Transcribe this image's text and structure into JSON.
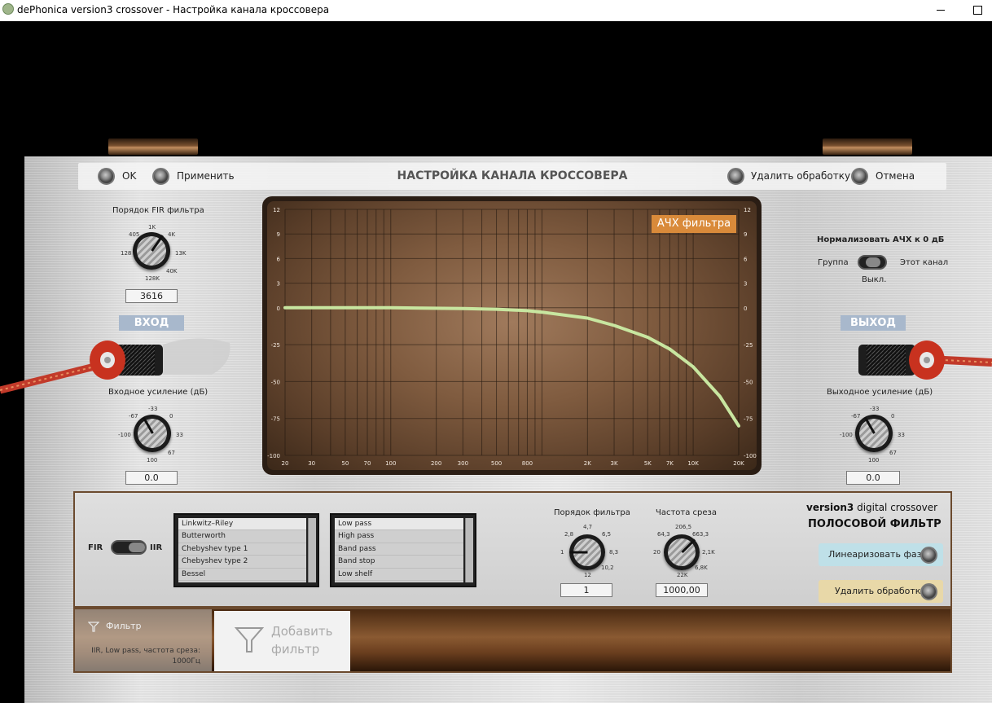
{
  "window": {
    "title": "dePhonica version3 crossover - Настройка канала кроссовера"
  },
  "header": {
    "ok_label": "OK",
    "apply_label": "Применить",
    "title": "НАСТРОЙКА КАНАЛА КРОССОВЕРА",
    "remove_processing_label": "Удалить обработку",
    "cancel_label": "Отмена"
  },
  "fir_order": {
    "label": "Порядок FIR фильтра",
    "ticks": [
      "405",
      "1K",
      "4K",
      "128",
      "13K",
      "128K",
      "40K"
    ],
    "value": "3616"
  },
  "input": {
    "plaque": "ВХОД",
    "gain_label": "Входное усиление (дБ)",
    "ticks": [
      "-33",
      "-67",
      "0",
      "-100",
      "33",
      "100",
      "67"
    ],
    "value": "0.0"
  },
  "output": {
    "plaque": "ВЫХОД",
    "gain_label": "Выходное усиление (дБ)",
    "ticks": [
      "-33",
      "-67",
      "0",
      "-100",
      "33",
      "100",
      "67"
    ],
    "value": "0.0"
  },
  "normalize": {
    "title": "Нормализовать АЧХ к 0 дБ",
    "group_label": "Группа",
    "channel_label": "Этот канал",
    "off_label": "Выкл."
  },
  "graph": {
    "badge": "АЧХ фильтра"
  },
  "chart_data": {
    "type": "line",
    "title": "АЧХ фильтра",
    "xscale": "log",
    "x_ticks": [
      "20",
      "30",
      "50",
      "70",
      "100",
      "200",
      "300",
      "500",
      "800",
      "2K",
      "3K",
      "5K",
      "7K",
      "10K",
      "20K"
    ],
    "y_ticks": [
      "12",
      "9",
      "6",
      "3",
      "0",
      "-25",
      "-50",
      "-75",
      "-100"
    ],
    "xlim": [
      20,
      20000
    ],
    "series": [
      {
        "color": "#c8e6a0",
        "x": [
          20,
          100,
          300,
          500,
          800,
          1000,
          2000,
          3000,
          5000,
          7000,
          10000,
          15000,
          20000
        ],
        "y": [
          0,
          0,
          -0.5,
          -1,
          -2,
          -3,
          -7,
          -12,
          -20,
          -28,
          -40,
          -60,
          -80
        ]
      }
    ]
  },
  "lower": {
    "fir_label": "FIR",
    "iir_label": "IIR",
    "types": [
      "Linkwitz–Riley",
      "Butterworth",
      "Chebyshev type 1",
      "Chebyshev type 2",
      "Bessel"
    ],
    "passes": [
      "Low pass",
      "High pass",
      "Band pass",
      "Band stop",
      "Low shelf"
    ],
    "order_label": "Порядок фильтра",
    "order_ticks": [
      "4,7",
      "2,8",
      "6,5",
      "1",
      "8,3",
      "10,2",
      "12"
    ],
    "order_value": "1",
    "freq_label": "Частота среза",
    "freq_ticks": [
      "206,5",
      "64,3",
      "663,3",
      "20",
      "2,1K",
      "6,8K",
      "22K"
    ],
    "freq_value": "1000,00",
    "brand_bold": "version3",
    "brand_rest": " digital crossover",
    "subtitle": "ПОЛОСОВОЙ ФИЛЬТР",
    "linearize_label": "Линеаризовать фазу",
    "remove_label": "Удалить обработку"
  },
  "bottom": {
    "filter_title": "Фильтр",
    "filter_desc_1": "IIR, Low pass, частота среза:",
    "filter_desc_2": "1000Гц",
    "add_filter_1": "Добавить",
    "add_filter_2": "фильтр"
  },
  "colors": {
    "accent": "#d98a3a",
    "curve": "#c8e6a0",
    "plaque": "#a8b8cc"
  }
}
